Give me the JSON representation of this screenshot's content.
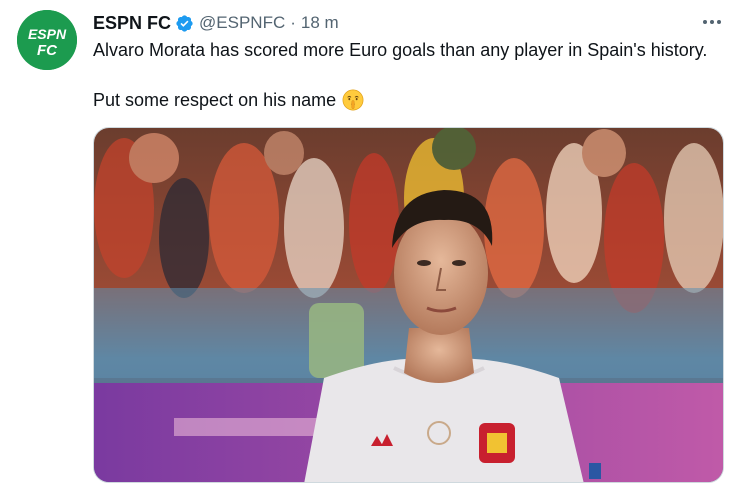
{
  "tweet": {
    "author_name": "ESPN FC",
    "handle": "@ESPNFC",
    "separator": "·",
    "time": "18 m",
    "verified": true,
    "text_line1": "Alvaro Morata has scored more Euro goals than any player in Spain's history.",
    "text_line2": "Put some respect on his name",
    "emoji": "shushing-face-icon"
  },
  "avatar": {
    "logo_text_top": "ESPN",
    "logo_text_bottom": "FC",
    "color": "#1c9b4f"
  },
  "icons": {
    "verified": "verified-badge-icon",
    "more": "more-dots-icon"
  },
  "colors": {
    "verified": "#1d9bf0",
    "secondary_text": "#536471",
    "primary_text": "#0f1419"
  }
}
